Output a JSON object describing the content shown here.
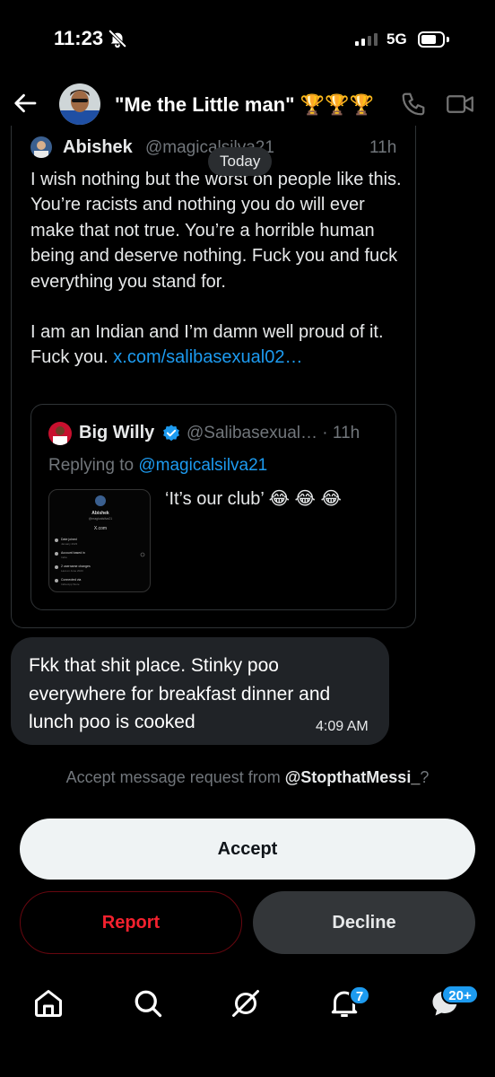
{
  "status_bar": {
    "time": "11:23",
    "network": "5G"
  },
  "header": {
    "title": "\"Me the Little man\" 🏆🏆🏆"
  },
  "date_separator": "Today",
  "post": {
    "author": "Abishek",
    "handle": "@magicalsilva21",
    "time": "11h",
    "paragraph1": "I wish nothing but the worst on people like this. You’re racists and nothing you do will ever make that not true. You’re a horrible human being and deserve nothing. Fuck you and fuck everything you stand for.",
    "paragraph2": "I am an Indian and I’m damn well proud of it. Fuck you. ",
    "link": "x.com/salibasexual02…",
    "quoted": {
      "author": "Big Willy",
      "meta": "@Salibasexual… · 11h",
      "replying_prefix": "Replying to ",
      "replying_handle": "@magicalsilva21",
      "text": "‘It’s our club’ 😂 😂 😂",
      "thumb": {
        "name": "Abishek",
        "handle": "@magicalsilva21",
        "site": "X.com",
        "rows": [
          {
            "label": "Date joined",
            "value": "January 2023"
          },
          {
            "label": "Account based in",
            "value": "India"
          },
          {
            "label": "2 username changes",
            "value": "Last on June 2023"
          },
          {
            "label": "Connected via",
            "value": "India App Store"
          }
        ]
      }
    }
  },
  "message": {
    "text": "Fkk that shit place. Stinky poo everywhere for breakfast dinner and lunch poo is cooked",
    "time": "4:09 AM"
  },
  "request": {
    "prefix": "Accept message request from ",
    "handle": "@StopthatMessi_",
    "suffix": "?"
  },
  "buttons": {
    "accept": "Accept",
    "report": "Report",
    "decline": "Decline"
  },
  "nav": {
    "notifications_badge": "7",
    "messages_badge": "20+"
  },
  "colors": {
    "accent": "#1d9bf0",
    "danger": "#f4212e",
    "background": "#000000",
    "bubble": "#202327"
  }
}
